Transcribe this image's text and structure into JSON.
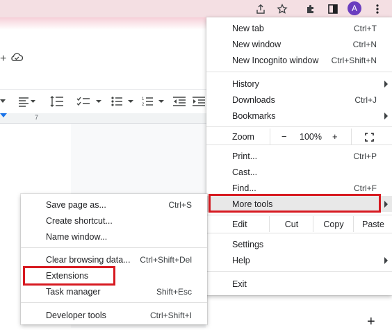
{
  "topbar": {
    "icons": [
      "share-icon",
      "star-icon",
      "extensions-puzzle-icon",
      "sidebar-icon",
      "more-vert-icon"
    ],
    "avatar_letter": "A",
    "avatar_color": "#6a3dbf"
  },
  "ruler": {
    "mark": "7"
  },
  "main_menu": {
    "new_tab": {
      "label": "New tab",
      "shortcut": "Ctrl+T"
    },
    "new_window": {
      "label": "New window",
      "shortcut": "Ctrl+N"
    },
    "new_incognito": {
      "label": "New Incognito window",
      "shortcut": "Ctrl+Shift+N"
    },
    "history": {
      "label": "History"
    },
    "downloads": {
      "label": "Downloads",
      "shortcut": "Ctrl+J"
    },
    "bookmarks": {
      "label": "Bookmarks"
    },
    "zoom": {
      "label": "Zoom",
      "minus": "−",
      "value": "100%",
      "plus": "+"
    },
    "print": {
      "label": "Print...",
      "shortcut": "Ctrl+P"
    },
    "cast": {
      "label": "Cast..."
    },
    "find": {
      "label": "Find...",
      "shortcut": "Ctrl+F"
    },
    "more_tools": {
      "label": "More tools"
    },
    "edit": {
      "label": "Edit",
      "cut": "Cut",
      "copy": "Copy",
      "paste": "Paste"
    },
    "settings": {
      "label": "Settings"
    },
    "help": {
      "label": "Help"
    },
    "exit": {
      "label": "Exit"
    }
  },
  "sub_menu": {
    "save_page": {
      "label": "Save page as...",
      "shortcut": "Ctrl+S"
    },
    "create_shortcut": {
      "label": "Create shortcut..."
    },
    "name_window": {
      "label": "Name window..."
    },
    "clear_data": {
      "label": "Clear browsing data...",
      "shortcut": "Ctrl+Shift+Del"
    },
    "extensions": {
      "label": "Extensions"
    },
    "task_manager": {
      "label": "Task manager",
      "shortcut": "Shift+Esc"
    },
    "developer_tools": {
      "label": "Developer tools",
      "shortcut": "Ctrl+Shift+I"
    }
  },
  "highlight_color": "#d71920"
}
